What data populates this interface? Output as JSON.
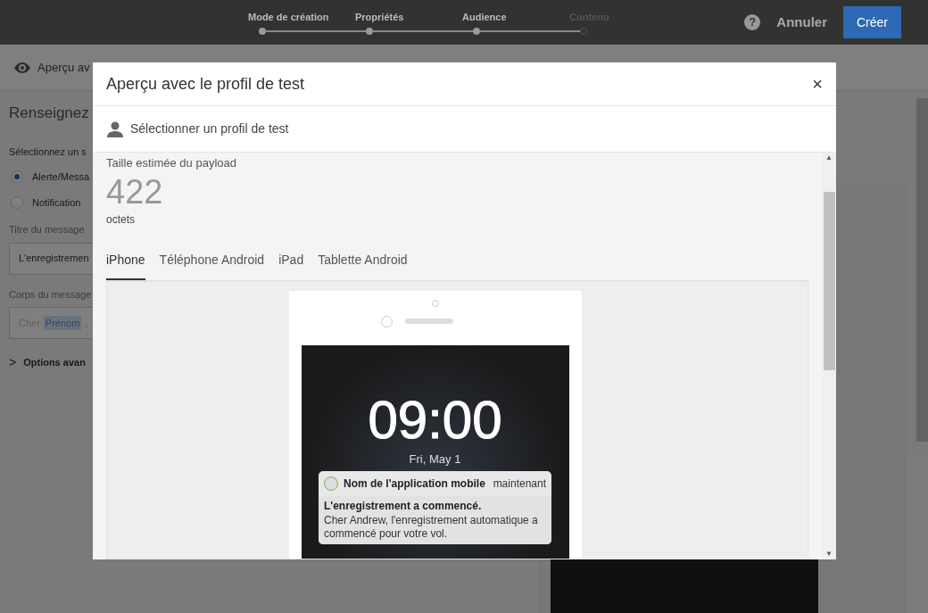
{
  "steps": [
    {
      "label": "Mode de création",
      "done": true
    },
    {
      "label": "Propriétés",
      "done": true
    },
    {
      "label": "Audience",
      "done": true
    },
    {
      "label": "Contenu",
      "done": false
    }
  ],
  "header_actions": {
    "help": "?",
    "cancel": "Annuler",
    "create": "Créer"
  },
  "background": {
    "toolbar_label": "Aperçu av",
    "heading": "Renseignez",
    "type_label": "Sélectionnez un s",
    "radios": [
      {
        "label": "Alerte/Messa",
        "selected": true
      },
      {
        "label": "Notification",
        "selected": false
      }
    ],
    "title_label": "Titre du message",
    "title_value": "L'enregistremen",
    "body_label": "Corps du message",
    "body_text": "Cher",
    "body_token": "Prénom",
    "body_rest": ",",
    "advanced_icon": ">",
    "advanced": "Options avan"
  },
  "dialog": {
    "title": "Aperçu avec le profil de test",
    "close": "×",
    "scroll_up": "▲",
    "scroll_down": "▼",
    "profile_button": "Sélectionner un profil de test",
    "payload_label": "Taille estimée du payload",
    "payload_value": "422",
    "payload_unit": "octets",
    "tabs": [
      {
        "label": "iPhone",
        "selected": true
      },
      {
        "label": "Téléphone Android",
        "selected": false
      },
      {
        "label": "iPad",
        "selected": false
      },
      {
        "label": "Tablette Android",
        "selected": false
      }
    ],
    "preview": {
      "time": "09:00",
      "date": "Fri, May 1",
      "app_name": "Nom de l'application mobile",
      "when": "maintenant",
      "notif_title": "L'enregistrement a commencé.",
      "notif_body": "Cher Andrew, l'enregistrement automatique a commencé pour votre vol."
    }
  }
}
